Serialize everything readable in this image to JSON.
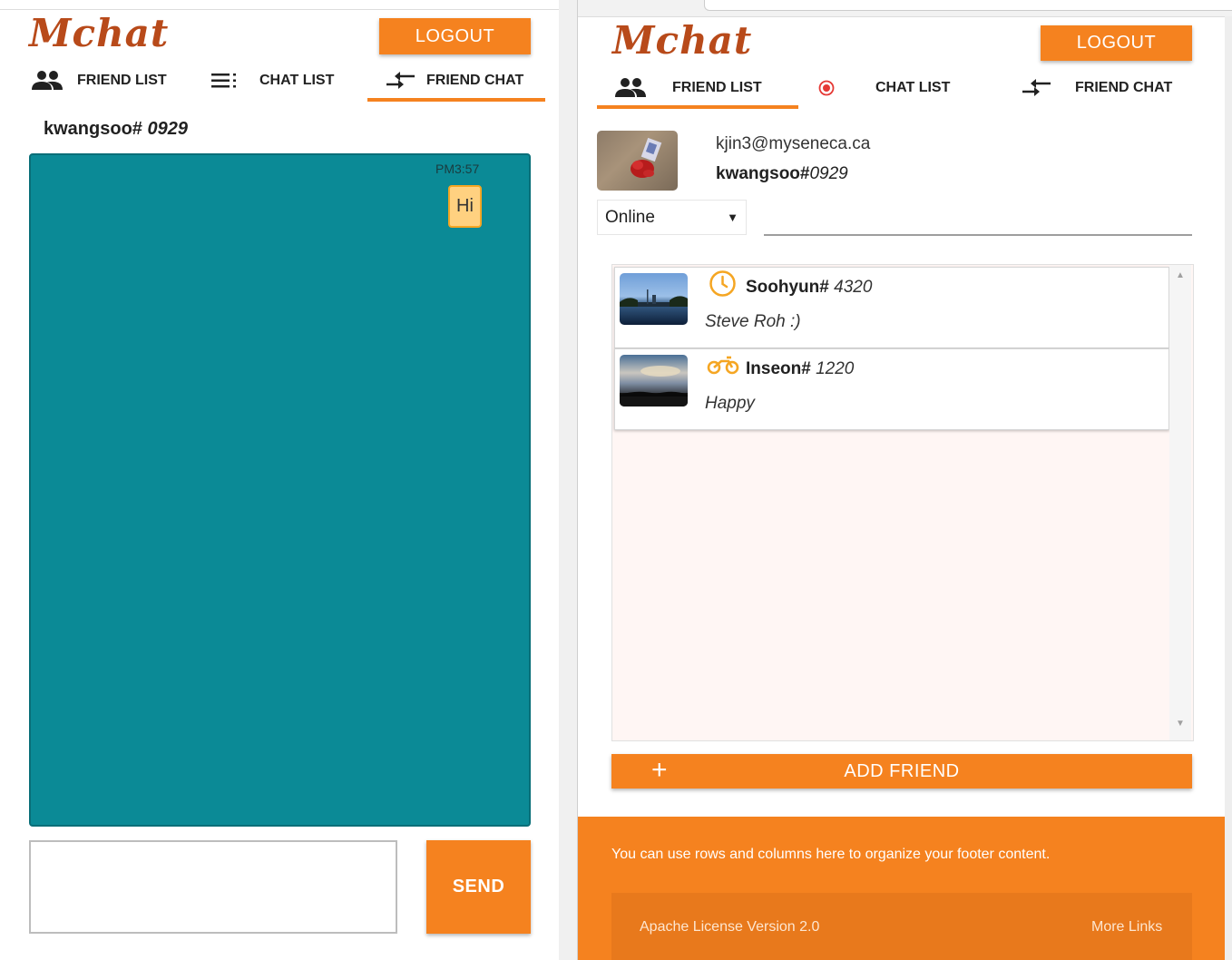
{
  "app": {
    "logo_text": "Mchat",
    "accent": "#f5821f",
    "teal": "#0b8a96"
  },
  "left": {
    "logout_label": "LOGOUT",
    "tabs": [
      {
        "label": "FRIEND LIST",
        "icon": "people-icon"
      },
      {
        "label": "CHAT LIST",
        "icon": "list-icon"
      },
      {
        "label": "FRIEND CHAT",
        "icon": "swap-arrows-icon",
        "active": true
      }
    ],
    "chat_user": {
      "name": "kwangsoo#",
      "tag": "0929"
    },
    "messages": [
      {
        "time": "PM3:57",
        "text": "Hi"
      }
    ],
    "message_input": {
      "value": "",
      "placeholder": ""
    },
    "send_label": "SEND"
  },
  "right": {
    "logout_label": "LOGOUT",
    "tabs": [
      {
        "label": "FRIEND LIST",
        "icon": "people-icon",
        "active": true
      },
      {
        "label": "CHAT LIST",
        "icon": "record-dot-icon"
      },
      {
        "label": "FRIEND CHAT",
        "icon": "swap-arrows-icon"
      }
    ],
    "profile": {
      "email": "kjin3@myseneca.ca",
      "name": "kwangsoo#",
      "tag": "0929",
      "status": "Online",
      "status_message": ""
    },
    "friends": [
      {
        "name": "Soohyun#",
        "tag": "4320",
        "status_text": "Steve Roh :)",
        "status_icon": "clock-icon"
      },
      {
        "name": "Inseon#",
        "tag": "1220",
        "status_text": "Happy",
        "status_icon": "motorbike-icon"
      }
    ],
    "add_friend_label": "ADD FRIEND",
    "footer": {
      "text": "You can use rows and columns here to organize your footer content.",
      "license": "Apache License Version 2.0",
      "more_links": "More Links"
    }
  }
}
